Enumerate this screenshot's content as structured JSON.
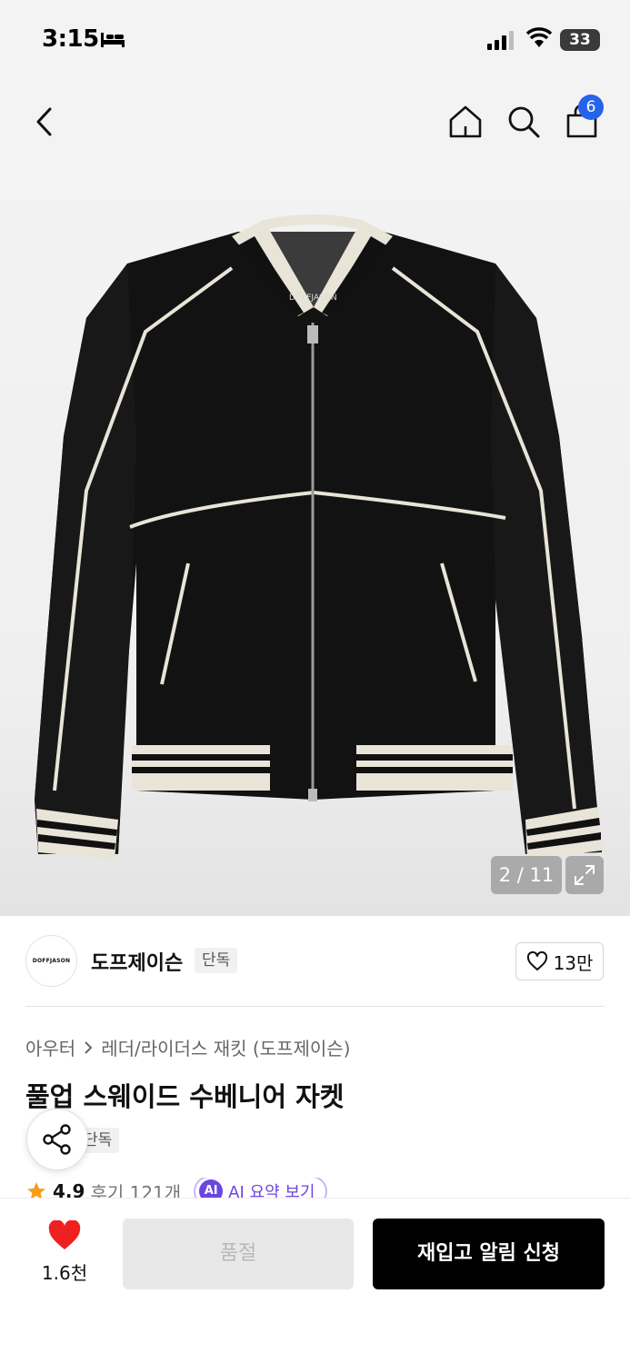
{
  "status_bar": {
    "time": "3:15",
    "battery": "33",
    "battery_level": 0.33
  },
  "nav": {
    "cart_count": "6"
  },
  "image": {
    "counter": "2 / 11",
    "jacket_tag": "DOFFJASON"
  },
  "brand": {
    "logo_text": "DOFFJASON",
    "name": "도프제이슨",
    "tag": "단독",
    "like_count": "13만"
  },
  "product": {
    "breadcrumb": [
      "아우터",
      "레더/라이더스 재킷 (도프제이슨)"
    ],
    "title": "풀업 스웨이드 수베니어 자켓",
    "tag": "단독",
    "rating": "4.9",
    "reviews": "후기 121개",
    "ai_badge": "AI",
    "ai_label": "AI 요약 보기"
  },
  "bottom": {
    "wish_count": "1.6천",
    "soldout_label": "품절",
    "restock_label": "재입고 알림 신청"
  },
  "colors": {
    "accent_blue": "#2563eb",
    "heart_red": "#ef2020",
    "ai_purple": "#6b46e0",
    "star_orange": "#f59e1b"
  }
}
